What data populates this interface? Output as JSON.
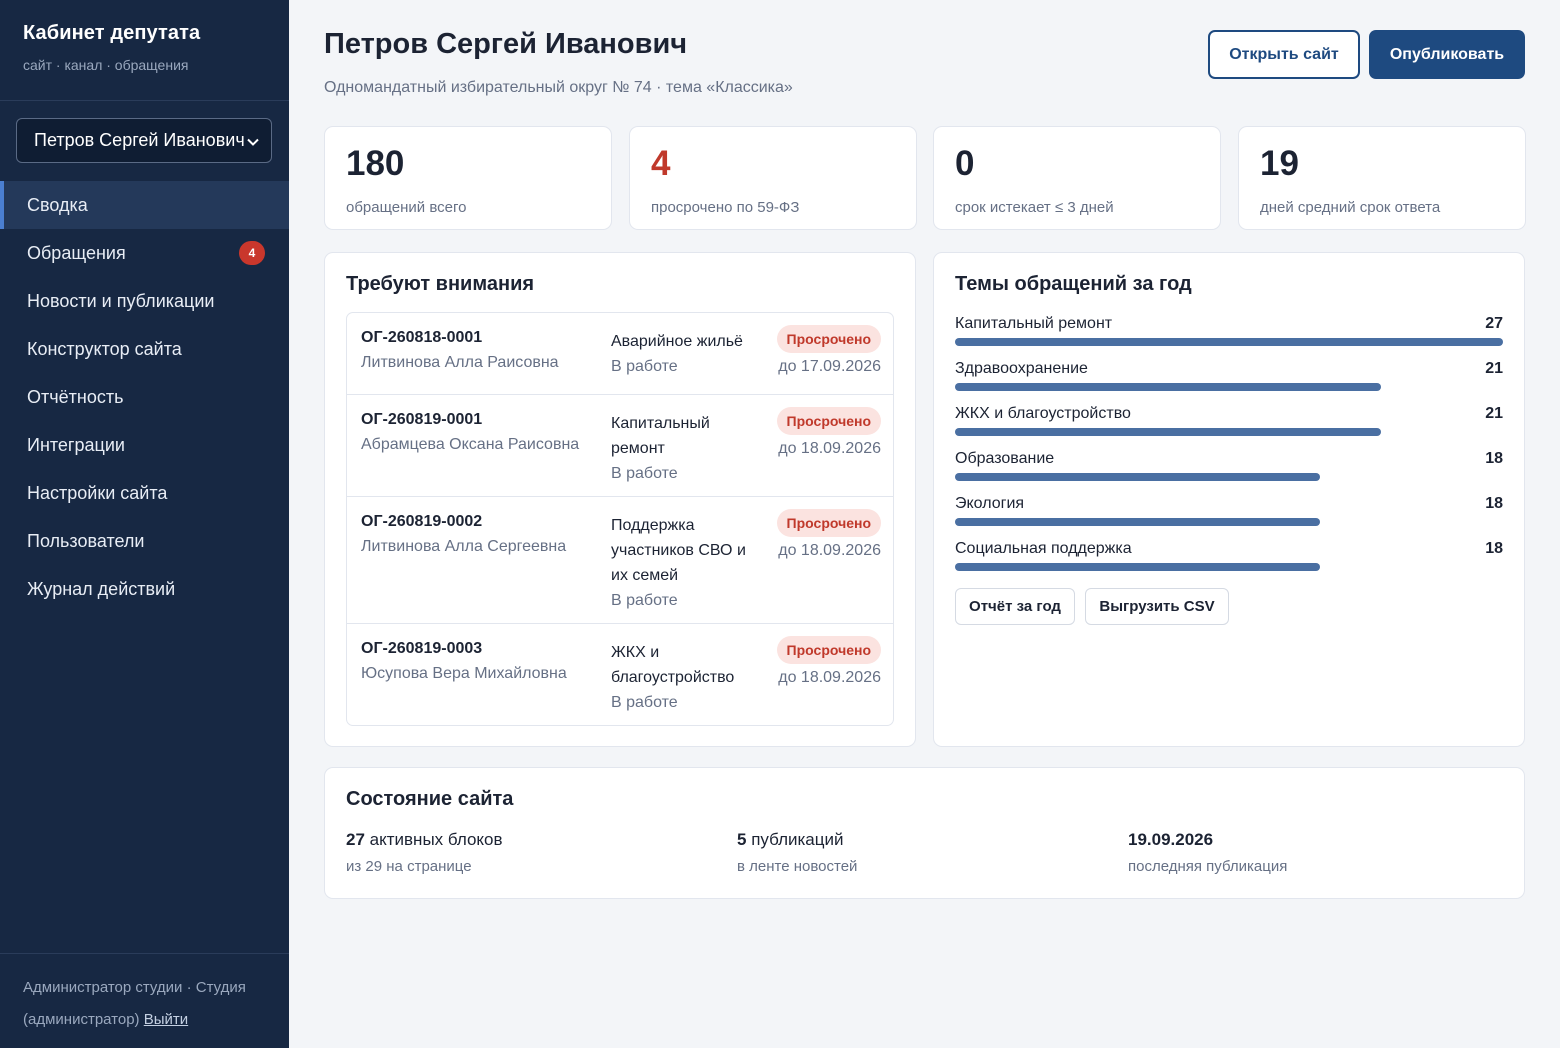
{
  "sidebar": {
    "title": "Кабинет депутата",
    "subtitle": "сайт · канал · обращения",
    "selector": "Петров Сергей Иванович",
    "items": [
      {
        "label": "Сводка"
      },
      {
        "label": "Обращения",
        "badge": "4"
      },
      {
        "label": "Новости и публикации"
      },
      {
        "label": "Конструктор сайта"
      },
      {
        "label": "Отчётность"
      },
      {
        "label": "Интеграции"
      },
      {
        "label": "Настройки сайта"
      },
      {
        "label": "Пользователи"
      },
      {
        "label": "Журнал действий"
      }
    ],
    "footer_text": "Администратор студии · Студия (администратор)",
    "logout": "Выйти"
  },
  "header": {
    "title": "Петров Сергей Иванович",
    "subtitle": "Одномандатный избирательный округ № 74 · тема «Классика»",
    "open_site": "Открыть сайт",
    "publish": "Опубликовать"
  },
  "stats": [
    {
      "value": "180",
      "label": "обращений всего"
    },
    {
      "value": "4",
      "label": "просрочено по 59-ФЗ",
      "accent": "#c0392b"
    },
    {
      "value": "0",
      "label": "срок истекает ≤ 3 дней"
    },
    {
      "value": "19",
      "label": "дней средний срок ответа"
    }
  ],
  "attention": {
    "title": "Требуют внимания",
    "rows": [
      {
        "id": "ОГ-260818-0001",
        "name": "Литвинова Алла Раисовна",
        "topic": "Аварийное жильё",
        "status": "В работе",
        "badge": "Просрочено",
        "due": "до 17.09.2026"
      },
      {
        "id": "ОГ-260819-0001",
        "name": "Абрамцева Оксана Раисовна",
        "topic": "Капитальный ремонт",
        "status": "В работе",
        "badge": "Просрочено",
        "due": "до 18.09.2026"
      },
      {
        "id": "ОГ-260819-0002",
        "name": "Литвинова Алла Сергеевна",
        "topic": "Поддержка участников СВО и их семей",
        "status": "В работе",
        "badge": "Просрочено",
        "due": "до 18.09.2026"
      },
      {
        "id": "ОГ-260819-0003",
        "name": "Юсупова Вера Михайловна",
        "topic": "ЖКХ и благоустройство",
        "status": "В работе",
        "badge": "Просрочено",
        "due": "до 18.09.2026"
      }
    ]
  },
  "topics": {
    "title": "Темы обращений за год",
    "max": 27,
    "items": [
      {
        "label": "Капитальный ремонт",
        "value": 27
      },
      {
        "label": "Здравоохранение",
        "value": 21
      },
      {
        "label": "ЖКХ и благоустройство",
        "value": 21
      },
      {
        "label": "Образование",
        "value": 18
      },
      {
        "label": "Экология",
        "value": 18
      },
      {
        "label": "Социальная поддержка",
        "value": 18
      }
    ],
    "report_btn": "Отчёт за год",
    "csv_btn": "Выгрузить CSV",
    "bar_color": "#4a6fa2"
  },
  "site_state": {
    "title": "Состояние сайта",
    "blocks": {
      "value": "27",
      "text": "активных блоков",
      "sub": "из 29 на странице"
    },
    "pubs": {
      "value": "5",
      "text": "публикаций",
      "sub": "в ленте новостей"
    },
    "last": {
      "value": "19.09.2026",
      "sub": "последняя публикация"
    }
  }
}
